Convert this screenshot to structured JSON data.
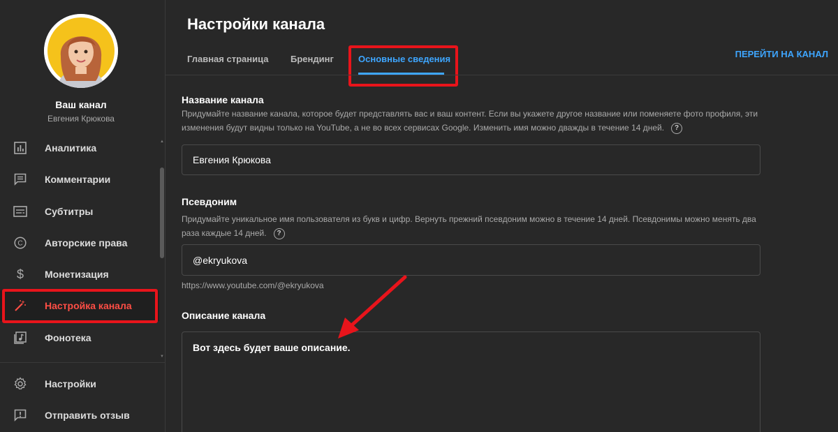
{
  "sidebar": {
    "channel_title": "Ваш канал",
    "channel_name": "Евгения Крюкова",
    "items": [
      {
        "label": "Аналитика",
        "icon": "analytics-icon"
      },
      {
        "label": "Комментарии",
        "icon": "comments-icon"
      },
      {
        "label": "Субтитры",
        "icon": "subtitles-icon"
      },
      {
        "label": "Авторские права",
        "icon": "copyright-icon"
      },
      {
        "label": "Монетизация",
        "icon": "dollar-icon"
      },
      {
        "label": "Настройка канала",
        "icon": "magic-wand-icon",
        "active": true
      },
      {
        "label": "Фонотека",
        "icon": "audio-library-icon"
      }
    ],
    "bottom_items": [
      {
        "label": "Настройки",
        "icon": "gear-icon"
      },
      {
        "label": "Отправить отзыв",
        "icon": "feedback-icon"
      }
    ]
  },
  "header": {
    "title": "Настройки канала",
    "tabs": [
      {
        "label": "Главная страница"
      },
      {
        "label": "Брендинг"
      },
      {
        "label": "Основные сведения",
        "active": true
      }
    ],
    "go_to_channel": "ПЕРЕЙТИ НА КАНАЛ"
  },
  "basic_info": {
    "name_section": {
      "title": "Название канала",
      "hint": "Придумайте название канала, которое будет представлять вас и ваш контент. Если вы укажете другое название или поменяете фото профиля, эти изменения будут видны только на YouTube, а не во всех сервисах Google. Изменить имя можно дважды в течение 14 дней.",
      "value": "Евгения Крюкова"
    },
    "handle_section": {
      "title": "Псевдоним",
      "hint": "Придумайте уникальное имя пользователя из букв и цифр. Вернуть прежний псевдоним можно в течение 14 дней. Псевдонимы можно менять два раза каждые 14 дней.",
      "value": "@ekryukova",
      "url": "https://www.youtube.com/@ekryukova"
    },
    "description_section": {
      "title": "Описание канала",
      "value": "Вот здесь будет ваше описание."
    },
    "help_glyph": "?"
  },
  "colors": {
    "background": "#282828",
    "accent": "#3ea6ff",
    "active_nav": "#ff4e45",
    "highlight_frame": "#e8141b"
  }
}
